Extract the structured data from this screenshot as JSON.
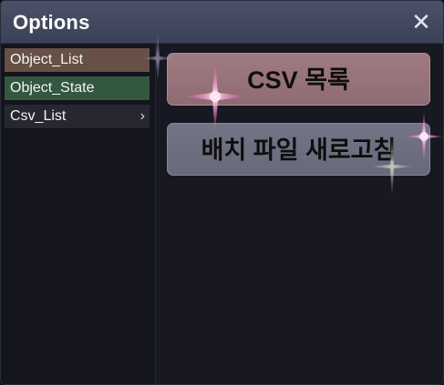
{
  "window": {
    "title": "Options",
    "close_glyph": "✕"
  },
  "sidebar": {
    "items": [
      {
        "label": "Object_List",
        "color": "#675045"
      },
      {
        "label": "Object_State",
        "color": "#33583f"
      },
      {
        "label": "Csv_List",
        "color": "#262730",
        "has_submenu": true,
        "chevron_glyph": "›"
      }
    ]
  },
  "content": {
    "buttons": [
      {
        "label": "CSV 목록",
        "color": "#a07a80"
      },
      {
        "label": "배치 파일 새로고침",
        "color": "#737586"
      }
    ]
  },
  "icons": [
    "close-icon",
    "chevron-right-icon",
    "sparkle-icon"
  ]
}
